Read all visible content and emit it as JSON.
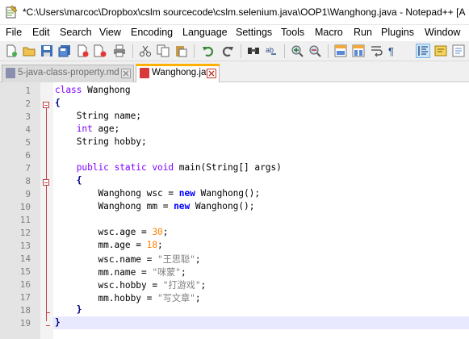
{
  "window": {
    "title": "*C:\\Users\\marcoc\\Dropbox\\cslm sourcecode\\cslm.selenium.java\\OOP1\\Wanghong.java - Notepad++ [A"
  },
  "menu": [
    "File",
    "Edit",
    "Search",
    "View",
    "Encoding",
    "Language",
    "Settings",
    "Tools",
    "Macro",
    "Run",
    "Plugins",
    "Window"
  ],
  "toolbar": {
    "icons": [
      "new-file-icon",
      "open-file-icon",
      "save-icon",
      "save-all-icon",
      "close-icon",
      "close-all-icon",
      "print-icon",
      "cut-icon",
      "copy-icon",
      "paste-icon",
      "undo-icon",
      "redo-icon",
      "find-icon",
      "replace-icon",
      "zoom-in-icon",
      "zoom-out-icon",
      "sync-vertical-icon",
      "sync-horizontal-icon",
      "word-wrap-icon",
      "show-all-chars-icon",
      "indent-guide-icon",
      "doc-map-icon",
      "function-list-icon"
    ]
  },
  "tabs": [
    {
      "label": "5-java-class-property.md",
      "active": false
    },
    {
      "label": "Wanghong.java",
      "active": true
    }
  ],
  "editor": {
    "line_numbers": [
      "1",
      "2",
      "3",
      "4",
      "5",
      "6",
      "7",
      "8",
      "9",
      "10",
      "11",
      "12",
      "13",
      "14",
      "15",
      "16",
      "17",
      "18",
      "19"
    ],
    "current_line": 19,
    "lines": [
      [
        {
          "t": "class",
          "c": "kw-blue"
        },
        {
          "t": " Wanghong",
          "c": ""
        }
      ],
      [
        {
          "t": "{",
          "c": "op"
        }
      ],
      [
        {
          "t": "    String name;",
          "c": ""
        }
      ],
      [
        {
          "t": "    ",
          "c": ""
        },
        {
          "t": "int",
          "c": "kw-type"
        },
        {
          "t": " age;",
          "c": ""
        }
      ],
      [
        {
          "t": "    String hobby;",
          "c": ""
        }
      ],
      [
        {
          "t": "",
          "c": ""
        }
      ],
      [
        {
          "t": "    ",
          "c": ""
        },
        {
          "t": "public",
          "c": "kw-blue"
        },
        {
          "t": " ",
          "c": ""
        },
        {
          "t": "static",
          "c": "kw-blue"
        },
        {
          "t": " ",
          "c": ""
        },
        {
          "t": "void",
          "c": "kw-type"
        },
        {
          "t": " main(String[] args)",
          "c": ""
        }
      ],
      [
        {
          "t": "    ",
          "c": ""
        },
        {
          "t": "{",
          "c": "op"
        }
      ],
      [
        {
          "t": "        Wanghong wsc = ",
          "c": ""
        },
        {
          "t": "new",
          "c": "kw-new"
        },
        {
          "t": " Wanghong();",
          "c": ""
        }
      ],
      [
        {
          "t": "        Wanghong mm = ",
          "c": ""
        },
        {
          "t": "new",
          "c": "kw-new"
        },
        {
          "t": " Wanghong();",
          "c": ""
        }
      ],
      [
        {
          "t": "",
          "c": ""
        }
      ],
      [
        {
          "t": "        wsc.age = ",
          "c": ""
        },
        {
          "t": "30",
          "c": "num"
        },
        {
          "t": ";",
          "c": ""
        }
      ],
      [
        {
          "t": "        mm.age = ",
          "c": ""
        },
        {
          "t": "18",
          "c": "num"
        },
        {
          "t": ";",
          "c": ""
        }
      ],
      [
        {
          "t": "        wsc.name = ",
          "c": ""
        },
        {
          "t": "\"王思聪\"",
          "c": "str"
        },
        {
          "t": ";",
          "c": ""
        }
      ],
      [
        {
          "t": "        mm.name = ",
          "c": ""
        },
        {
          "t": "\"咪蒙\"",
          "c": "str"
        },
        {
          "t": ";",
          "c": ""
        }
      ],
      [
        {
          "t": "        wsc.hobby = ",
          "c": ""
        },
        {
          "t": "\"打游戏\"",
          "c": "str"
        },
        {
          "t": ";",
          "c": ""
        }
      ],
      [
        {
          "t": "        mm.hobby = ",
          "c": ""
        },
        {
          "t": "\"写文章\"",
          "c": "str"
        },
        {
          "t": ";",
          "c": ""
        }
      ],
      [
        {
          "t": "    ",
          "c": ""
        },
        {
          "t": "}",
          "c": "op"
        }
      ],
      [
        {
          "t": "}",
          "c": "op"
        }
      ]
    ]
  },
  "colors": {
    "keyword": "#8000ff",
    "new_keyword": "#0000ff",
    "number": "#ff8000",
    "string": "#808080",
    "active_tab_accent": "#ffb000",
    "current_line_bg": "#e8e8ff"
  }
}
